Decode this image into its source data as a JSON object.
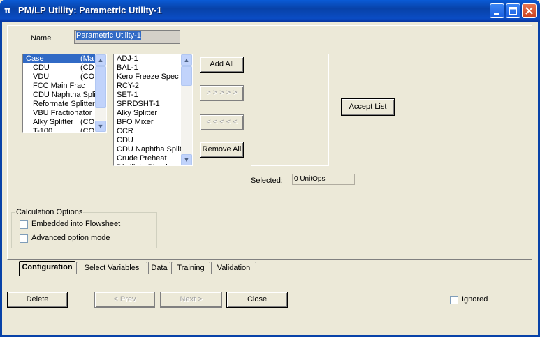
{
  "window": {
    "title": "PM/LP Utility: Parametric Utility-1",
    "title_icon": "π",
    "controls": [
      "minimize",
      "maximize",
      "close"
    ]
  },
  "name_field": {
    "label": "Name",
    "value": "Parametric Utility-1"
  },
  "case_list": {
    "rows": [
      {
        "name": "Case",
        "tag": "(Ma",
        "selected": true
      },
      {
        "name": "CDU",
        "tag": "(CD",
        "selected": false,
        "indent": true
      },
      {
        "name": "VDU",
        "tag": "(CO",
        "selected": false,
        "indent": true
      },
      {
        "name": "FCC Main Frac",
        "tag": "",
        "selected": false,
        "indent": true
      },
      {
        "name": "CDU Naphtha Spli",
        "tag": "",
        "selected": false,
        "indent": true
      },
      {
        "name": "Reformate Splitter",
        "tag": "",
        "selected": false,
        "indent": true
      },
      {
        "name": "VBU Fractionator",
        "tag": "",
        "selected": false,
        "indent": true
      },
      {
        "name": "Alky Splitter",
        "tag": "(CO",
        "selected": false,
        "indent": true
      },
      {
        "name": "T-100",
        "tag": "(CO",
        "selected": false,
        "indent": true
      }
    ]
  },
  "unitop_list": {
    "rows": [
      "ADJ-1",
      "BAL-1",
      "Kero Freeze Spec",
      "RCY-2",
      "SET-1",
      "SPRDSHT-1",
      "Alky Splitter",
      "BFO Mixer",
      "CCR",
      "CDU",
      "CDU Naphtha Split",
      "Crude Preheat",
      "Distillate Blend"
    ]
  },
  "buttons": {
    "add_all": "Add All",
    "add_selected": "> > > > >",
    "remove_selected": "< < < < <",
    "remove_all": "Remove All",
    "accept_list": "Accept List",
    "delete": "Delete",
    "prev": "< Prev",
    "next": "Next >",
    "close": "Close"
  },
  "selected": {
    "label": "Selected:",
    "value": "0 UnitOps"
  },
  "calc_options": {
    "title": "Calculation Options",
    "embedded": {
      "label": "Embedded into Flowsheet",
      "checked": false
    },
    "advanced": {
      "label": "Advanced option mode",
      "checked": false
    }
  },
  "tabs": [
    "Configuration",
    "Select Variables",
    "Data",
    "Training",
    "Validation"
  ],
  "active_tab": "Configuration",
  "ignored": {
    "label": "Ignored",
    "checked": false
  },
  "colors": {
    "titlebar": "#0a4cc4",
    "selection": "#316ac5",
    "face": "#ece9d8"
  }
}
